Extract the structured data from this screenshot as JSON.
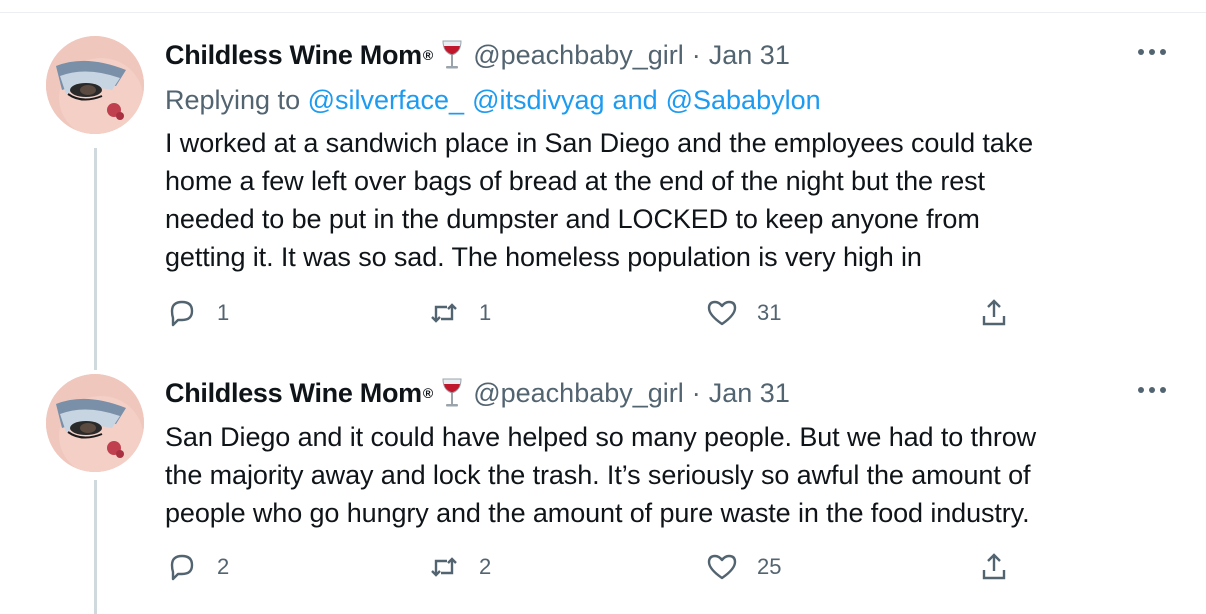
{
  "tweets": [
    {
      "name": "Childless Wine Mom",
      "reg_mark": "®",
      "handle": "@peachbaby_girl",
      "separator": "·",
      "date": "Jan 31",
      "replying_prefix": "Replying to",
      "replying_to": [
        "@silverface_",
        "@itsdivyag",
        "and",
        "@Sababylon"
      ],
      "text_lines": [
        "I worked at a sandwich place in San Diego and the employees could take",
        "home a few left over bags of bread at the end of the night but the rest",
        "needed to be put in the dumpster and LOCKED to keep anyone from",
        "getting it. It was so sad. The homeless population is very high in"
      ],
      "reply_count": "1",
      "retweet_count": "1",
      "like_count": "31"
    },
    {
      "name": "Childless Wine Mom",
      "reg_mark": "®",
      "handle": "@peachbaby_girl",
      "separator": "·",
      "date": "Jan 31",
      "text_lines": [
        "San Diego and it could have helped so many people. But we had to throw",
        "the majority away and lock the trash. It’s seriously so awful the amount of",
        "people who go hungry and the amount of pure waste in the food industry."
      ],
      "reply_count": "2",
      "retweet_count": "2",
      "like_count": "25"
    }
  ],
  "icons": {
    "reply": "reply-icon",
    "retweet": "retweet-icon",
    "like": "heart-icon",
    "share": "share-icon",
    "more": "more-icon",
    "wine": "wine-glass-icon"
  },
  "colors": {
    "text": "#0f1419",
    "secondary": "#536471",
    "link": "#1d9bf0",
    "thread_line": "#cfd9de"
  }
}
